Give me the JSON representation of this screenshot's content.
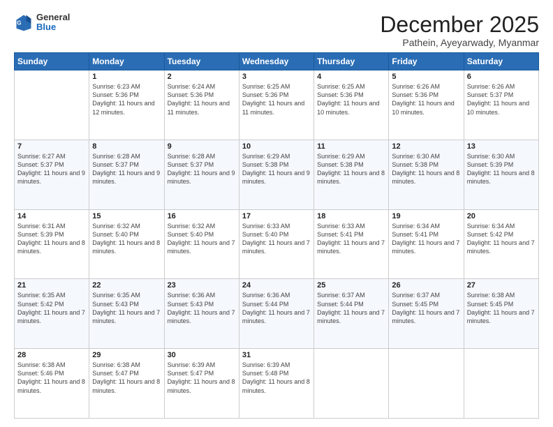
{
  "header": {
    "logo_general": "General",
    "logo_blue": "Blue",
    "month_title": "December 2025",
    "subtitle": "Pathein, Ayeyarwady, Myanmar"
  },
  "weekdays": [
    "Sunday",
    "Monday",
    "Tuesday",
    "Wednesday",
    "Thursday",
    "Friday",
    "Saturday"
  ],
  "weeks": [
    [
      {
        "day": "",
        "sunrise": "",
        "sunset": "",
        "daylight": ""
      },
      {
        "day": "1",
        "sunrise": "Sunrise: 6:23 AM",
        "sunset": "Sunset: 5:36 PM",
        "daylight": "Daylight: 11 hours and 12 minutes."
      },
      {
        "day": "2",
        "sunrise": "Sunrise: 6:24 AM",
        "sunset": "Sunset: 5:36 PM",
        "daylight": "Daylight: 11 hours and 11 minutes."
      },
      {
        "day": "3",
        "sunrise": "Sunrise: 6:25 AM",
        "sunset": "Sunset: 5:36 PM",
        "daylight": "Daylight: 11 hours and 11 minutes."
      },
      {
        "day": "4",
        "sunrise": "Sunrise: 6:25 AM",
        "sunset": "Sunset: 5:36 PM",
        "daylight": "Daylight: 11 hours and 10 minutes."
      },
      {
        "day": "5",
        "sunrise": "Sunrise: 6:26 AM",
        "sunset": "Sunset: 5:36 PM",
        "daylight": "Daylight: 11 hours and 10 minutes."
      },
      {
        "day": "6",
        "sunrise": "Sunrise: 6:26 AM",
        "sunset": "Sunset: 5:37 PM",
        "daylight": "Daylight: 11 hours and 10 minutes."
      }
    ],
    [
      {
        "day": "7",
        "sunrise": "Sunrise: 6:27 AM",
        "sunset": "Sunset: 5:37 PM",
        "daylight": "Daylight: 11 hours and 9 minutes."
      },
      {
        "day": "8",
        "sunrise": "Sunrise: 6:28 AM",
        "sunset": "Sunset: 5:37 PM",
        "daylight": "Daylight: 11 hours and 9 minutes."
      },
      {
        "day": "9",
        "sunrise": "Sunrise: 6:28 AM",
        "sunset": "Sunset: 5:37 PM",
        "daylight": "Daylight: 11 hours and 9 minutes."
      },
      {
        "day": "10",
        "sunrise": "Sunrise: 6:29 AM",
        "sunset": "Sunset: 5:38 PM",
        "daylight": "Daylight: 11 hours and 9 minutes."
      },
      {
        "day": "11",
        "sunrise": "Sunrise: 6:29 AM",
        "sunset": "Sunset: 5:38 PM",
        "daylight": "Daylight: 11 hours and 8 minutes."
      },
      {
        "day": "12",
        "sunrise": "Sunrise: 6:30 AM",
        "sunset": "Sunset: 5:38 PM",
        "daylight": "Daylight: 11 hours and 8 minutes."
      },
      {
        "day": "13",
        "sunrise": "Sunrise: 6:30 AM",
        "sunset": "Sunset: 5:39 PM",
        "daylight": "Daylight: 11 hours and 8 minutes."
      }
    ],
    [
      {
        "day": "14",
        "sunrise": "Sunrise: 6:31 AM",
        "sunset": "Sunset: 5:39 PM",
        "daylight": "Daylight: 11 hours and 8 minutes."
      },
      {
        "day": "15",
        "sunrise": "Sunrise: 6:32 AM",
        "sunset": "Sunset: 5:40 PM",
        "daylight": "Daylight: 11 hours and 8 minutes."
      },
      {
        "day": "16",
        "sunrise": "Sunrise: 6:32 AM",
        "sunset": "Sunset: 5:40 PM",
        "daylight": "Daylight: 11 hours and 7 minutes."
      },
      {
        "day": "17",
        "sunrise": "Sunrise: 6:33 AM",
        "sunset": "Sunset: 5:40 PM",
        "daylight": "Daylight: 11 hours and 7 minutes."
      },
      {
        "day": "18",
        "sunrise": "Sunrise: 6:33 AM",
        "sunset": "Sunset: 5:41 PM",
        "daylight": "Daylight: 11 hours and 7 minutes."
      },
      {
        "day": "19",
        "sunrise": "Sunrise: 6:34 AM",
        "sunset": "Sunset: 5:41 PM",
        "daylight": "Daylight: 11 hours and 7 minutes."
      },
      {
        "day": "20",
        "sunrise": "Sunrise: 6:34 AM",
        "sunset": "Sunset: 5:42 PM",
        "daylight": "Daylight: 11 hours and 7 minutes."
      }
    ],
    [
      {
        "day": "21",
        "sunrise": "Sunrise: 6:35 AM",
        "sunset": "Sunset: 5:42 PM",
        "daylight": "Daylight: 11 hours and 7 minutes."
      },
      {
        "day": "22",
        "sunrise": "Sunrise: 6:35 AM",
        "sunset": "Sunset: 5:43 PM",
        "daylight": "Daylight: 11 hours and 7 minutes."
      },
      {
        "day": "23",
        "sunrise": "Sunrise: 6:36 AM",
        "sunset": "Sunset: 5:43 PM",
        "daylight": "Daylight: 11 hours and 7 minutes."
      },
      {
        "day": "24",
        "sunrise": "Sunrise: 6:36 AM",
        "sunset": "Sunset: 5:44 PM",
        "daylight": "Daylight: 11 hours and 7 minutes."
      },
      {
        "day": "25",
        "sunrise": "Sunrise: 6:37 AM",
        "sunset": "Sunset: 5:44 PM",
        "daylight": "Daylight: 11 hours and 7 minutes."
      },
      {
        "day": "26",
        "sunrise": "Sunrise: 6:37 AM",
        "sunset": "Sunset: 5:45 PM",
        "daylight": "Daylight: 11 hours and 7 minutes."
      },
      {
        "day": "27",
        "sunrise": "Sunrise: 6:38 AM",
        "sunset": "Sunset: 5:45 PM",
        "daylight": "Daylight: 11 hours and 7 minutes."
      }
    ],
    [
      {
        "day": "28",
        "sunrise": "Sunrise: 6:38 AM",
        "sunset": "Sunset: 5:46 PM",
        "daylight": "Daylight: 11 hours and 8 minutes."
      },
      {
        "day": "29",
        "sunrise": "Sunrise: 6:38 AM",
        "sunset": "Sunset: 5:47 PM",
        "daylight": "Daylight: 11 hours and 8 minutes."
      },
      {
        "day": "30",
        "sunrise": "Sunrise: 6:39 AM",
        "sunset": "Sunset: 5:47 PM",
        "daylight": "Daylight: 11 hours and 8 minutes."
      },
      {
        "day": "31",
        "sunrise": "Sunrise: 6:39 AM",
        "sunset": "Sunset: 5:48 PM",
        "daylight": "Daylight: 11 hours and 8 minutes."
      },
      {
        "day": "",
        "sunrise": "",
        "sunset": "",
        "daylight": ""
      },
      {
        "day": "",
        "sunrise": "",
        "sunset": "",
        "daylight": ""
      },
      {
        "day": "",
        "sunrise": "",
        "sunset": "",
        "daylight": ""
      }
    ]
  ]
}
